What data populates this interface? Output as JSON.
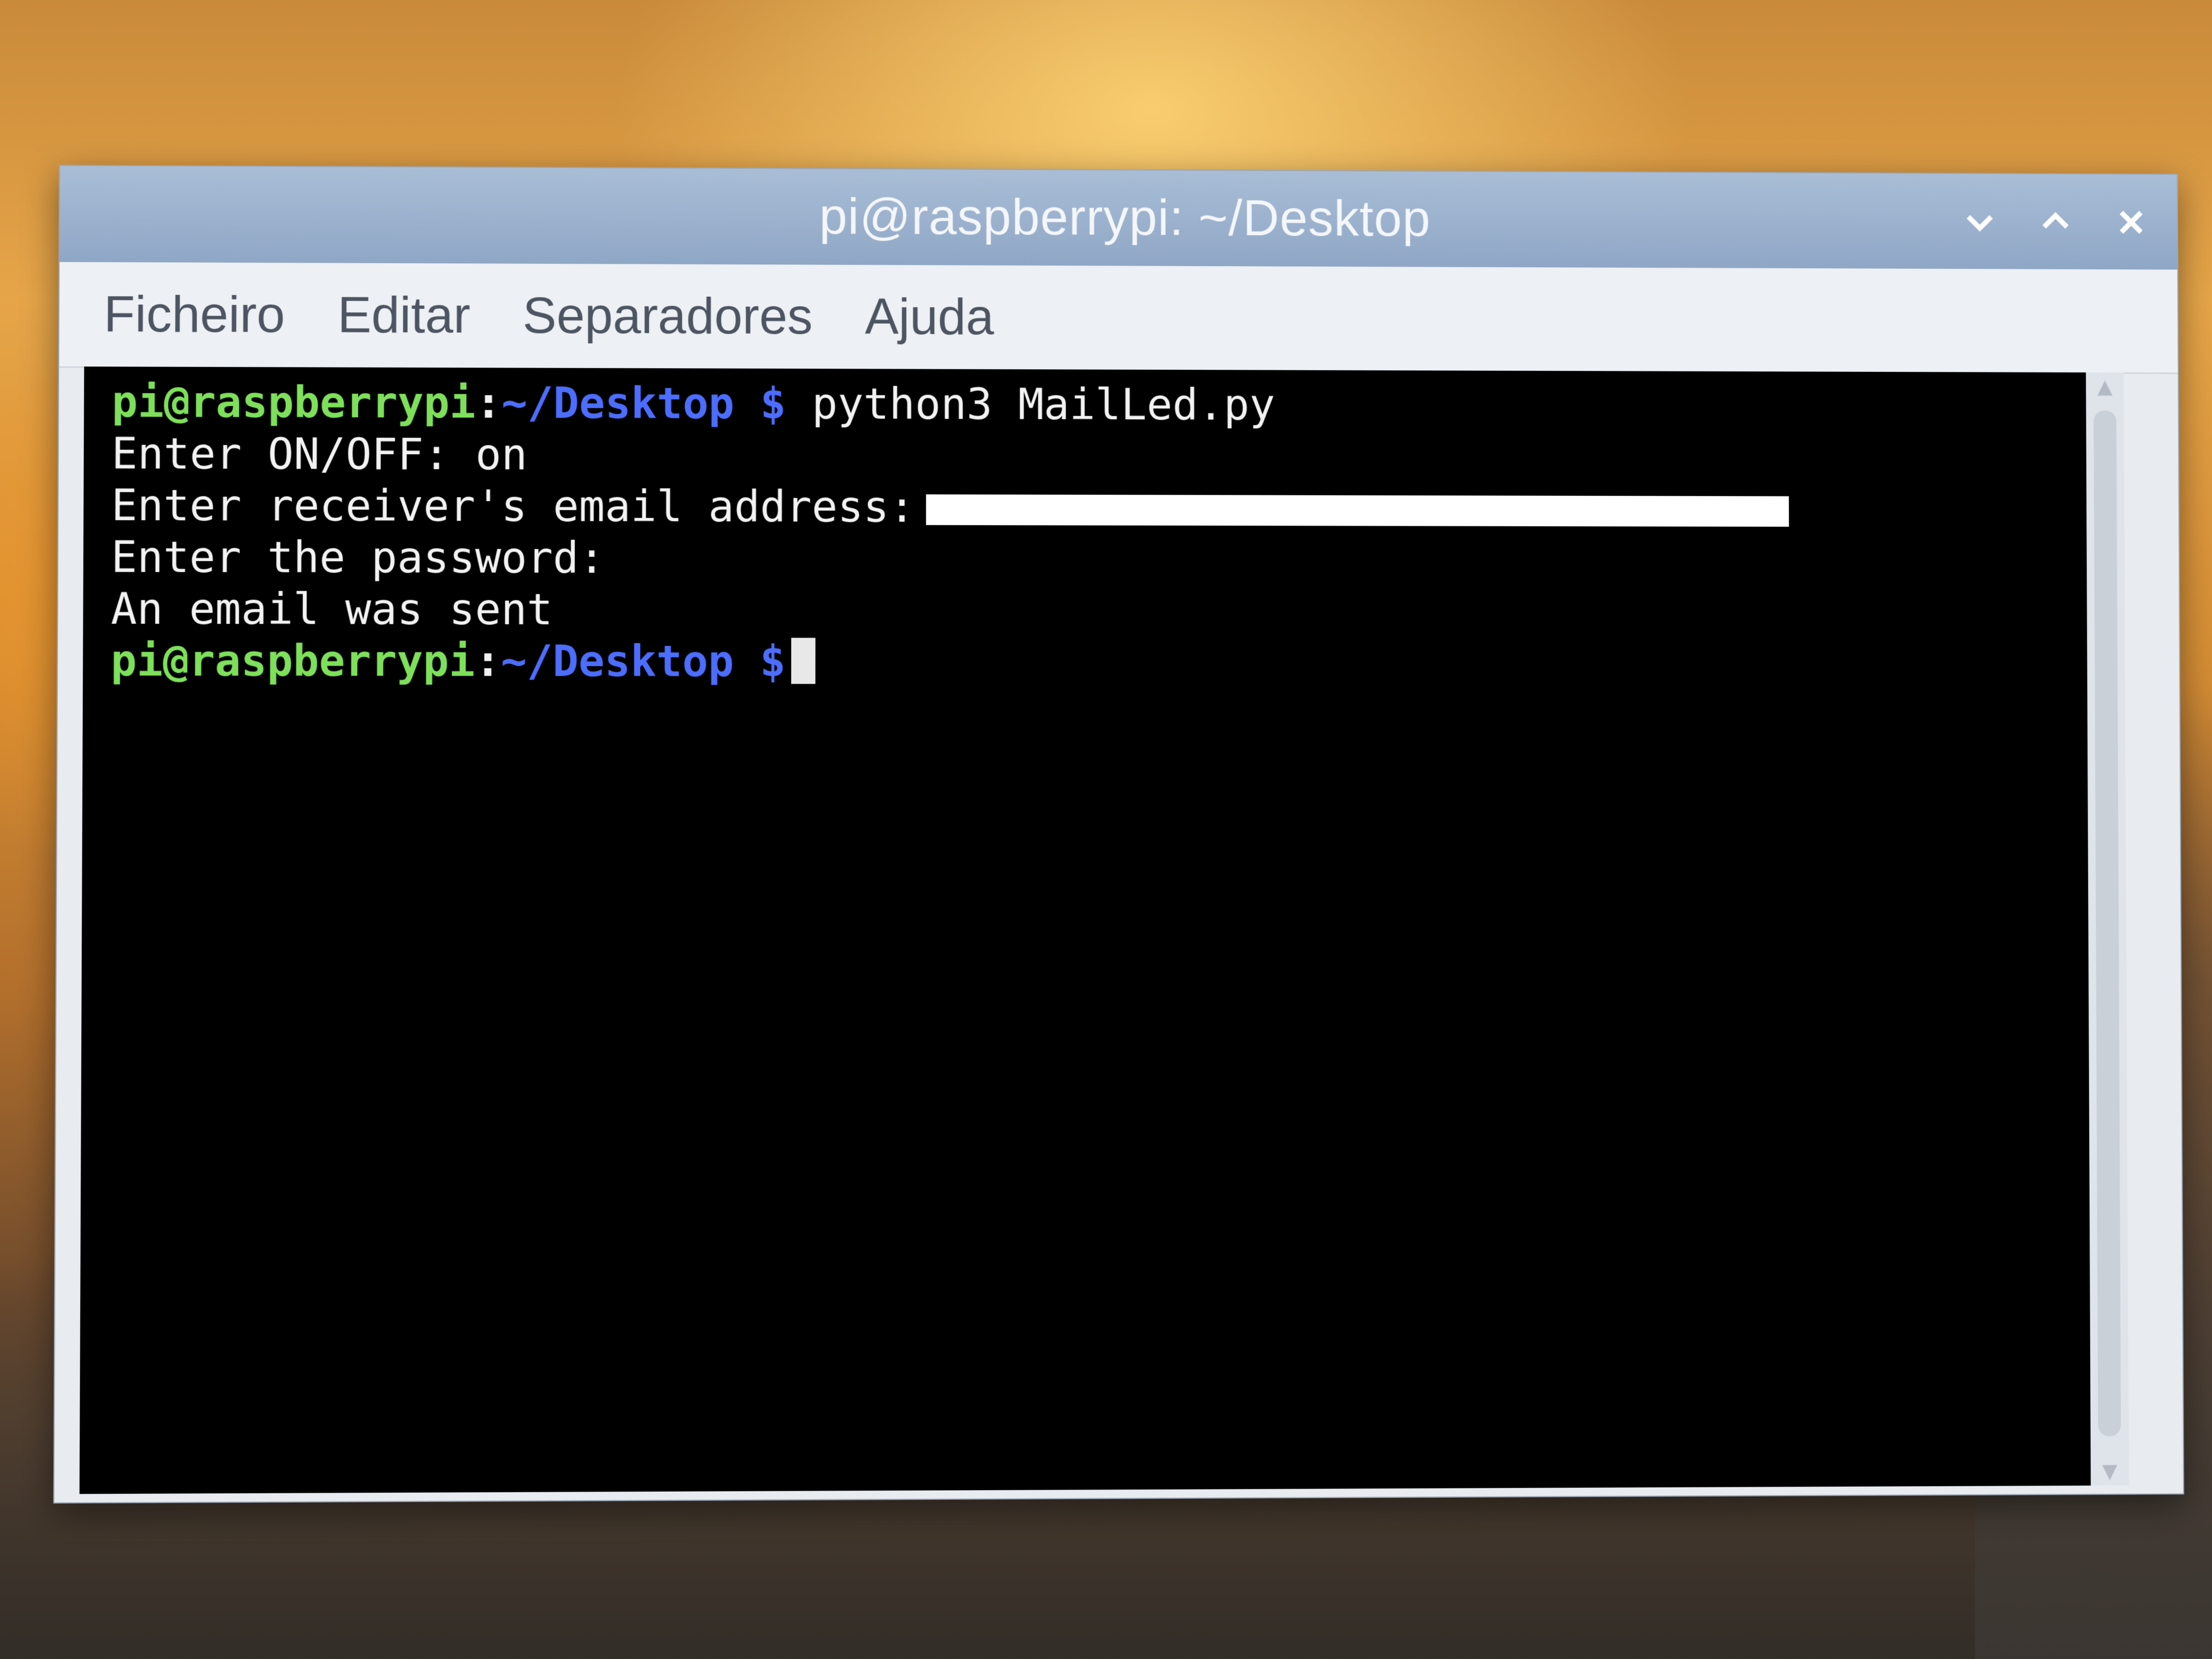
{
  "window": {
    "title": "pi@raspberrypi: ~/Desktop",
    "buttons": [
      "minimize-icon",
      "maximize-icon",
      "close-icon"
    ]
  },
  "menubar": {
    "items": [
      "Ficheiro",
      "Editar",
      "Separadores",
      "Ajuda"
    ]
  },
  "terminal": {
    "prompt_user": "pi@raspberrypi",
    "prompt_colon": ":",
    "prompt_path": "~/Desktop $",
    "command": "python3 MailLed.py",
    "output": [
      "Enter ON/OFF: on",
      "Enter receiver's email address:",
      "Enter the password:",
      "An email was sent"
    ],
    "colors": {
      "user": "#7ee05a",
      "path": "#4c6dff",
      "text": "#f2f2f2",
      "background": "#000000"
    }
  }
}
